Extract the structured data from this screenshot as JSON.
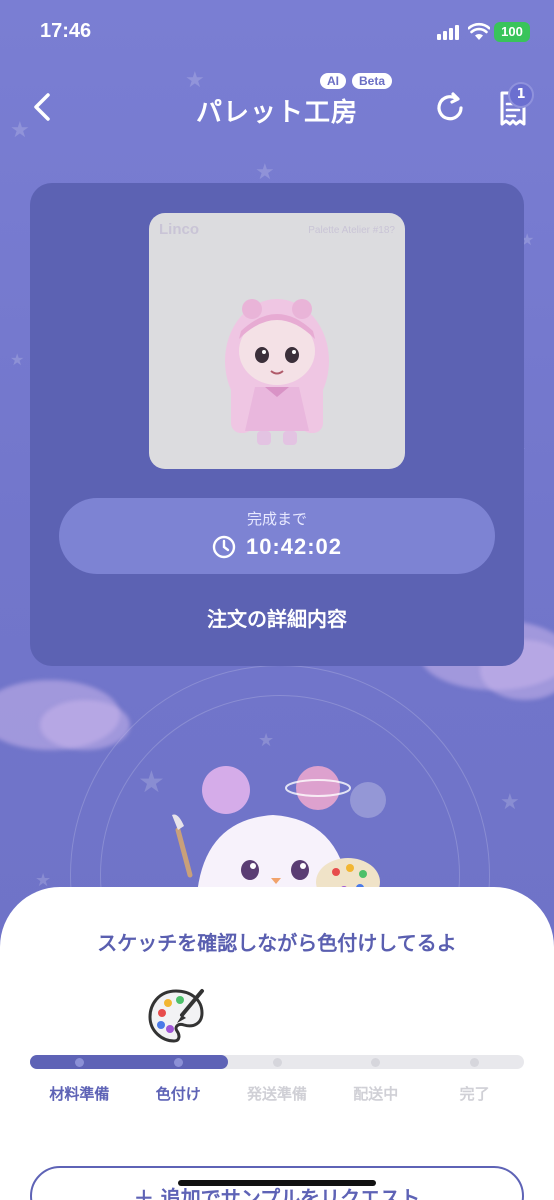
{
  "status": {
    "time": "17:46",
    "battery": "100"
  },
  "nav": {
    "title": "パレット工房",
    "badge_ai": "AI",
    "badge_beta": "Beta",
    "notif_count": "1"
  },
  "order": {
    "brand": "Linco",
    "serial": "Palette Atelier #18?",
    "countdown_label": "完成まで",
    "countdown": "10:42:02",
    "details_link": "注文の詳細内容"
  },
  "progress": {
    "message": "スケッチを確認しながら色付けしてるよ",
    "steps": [
      "材料準備",
      "色付け",
      "発送準備",
      "配送中",
      "完了"
    ],
    "current_step": 2,
    "accent": "#5e63b6",
    "inactive": "#d0d0d6"
  },
  "bottom": {
    "button": "＋ 追加でサンプルをリクエスト"
  }
}
